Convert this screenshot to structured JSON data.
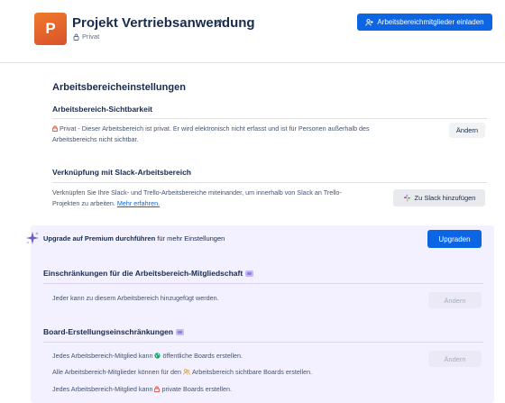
{
  "header": {
    "logo_letter": "P",
    "workspace_title": "Projekt Vertriebsanwendung",
    "privacy_label": "Privat",
    "invite_button_label": "Arbeitsbereichmitglieder einladen"
  },
  "settings": {
    "title": "Arbeitsbereicheinstellungen",
    "visibility": {
      "title": "Arbeitsbereich-Sichtbarkeit",
      "desc_line1": "Privat - Dieser Arbeitsbereich ist privat. Er wird elektronisch nicht erfasst und ist für Personen außerhalb des",
      "desc_line2": "Arbeitsbereichs nicht sichtbar.",
      "change_button": "Ändern"
    },
    "slack": {
      "title": "Verknüpfung mit Slack-Arbeitsbereich",
      "desc_line1": "Verknüpfen Sie Ihre Slack- und Trello-Arbeitsbereiche miteinander, um innerhalb von Slack an Trello-",
      "desc_line2": "Projekten zu arbeiten.",
      "learn_more": "Mehr erfahren.",
      "add_button": "Zu Slack hinzufügen"
    }
  },
  "premium": {
    "upgrade_bold": "Upgrade auf Premium durchführen",
    "upgrade_rest": " für mehr Einstellungen",
    "upgrade_button": "Upgraden",
    "membership": {
      "title": "Einschränkungen für die Arbeitsbereich-Mitgliedschaft",
      "desc": "Jeder kann zu diesem Arbeitsbereich hinzugefügt werden.",
      "change_button": "Ändern"
    },
    "board_creation": {
      "title": "Board-Erstellungseinschränkungen",
      "public_pre": "Jedes Arbeitsbereich-Mitglied kann",
      "public_post": "öffentliche Boards erstellen.",
      "workspace_pre": "Alle Arbeitsbereich-Mitglieder können für den",
      "workspace_post": "Arbeitsbereich sichtbare Boards erstellen.",
      "private_pre": "Jedes Arbeitsbereich-Mitglied kann",
      "private_post": "private Boards erstellen.",
      "change_button": "Ändern"
    }
  },
  "colors": {
    "primary": "#0c66e4",
    "logo_orange": "#e8662b",
    "premium_bg": "#f3f0ff",
    "lock_red": "#e34935",
    "public_green": "#22a06b",
    "workspace_orange": "#e2a03f"
  },
  "icons": [
    "pencil-icon",
    "lock-icon",
    "add-person-icon",
    "slack-icon",
    "sparkle-icon",
    "globe-icon",
    "people-icon"
  ]
}
